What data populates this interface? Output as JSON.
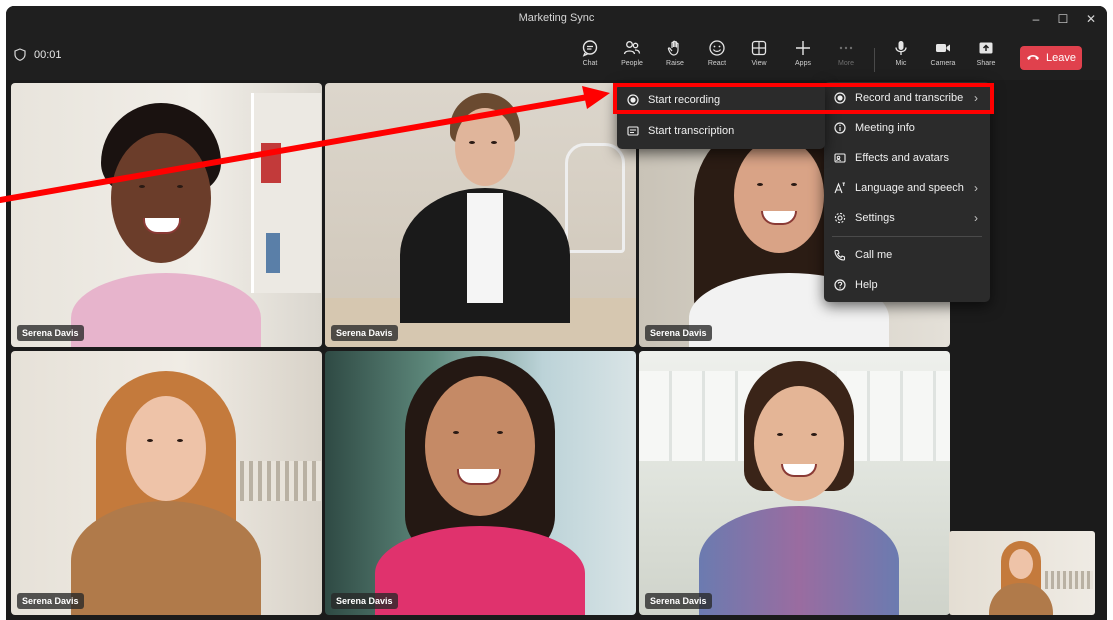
{
  "window": {
    "title": "Marketing Sync"
  },
  "titlebar_controls": {
    "minimize": "–",
    "maximize": "☐",
    "close": "✕"
  },
  "toolbar": {
    "timer": "00:01",
    "buttons": [
      {
        "label": "Chat",
        "icon": "chat-icon"
      },
      {
        "label": "People",
        "icon": "people-icon"
      },
      {
        "label": "Raise",
        "icon": "raise-hand-icon"
      },
      {
        "label": "React",
        "icon": "react-icon"
      },
      {
        "label": "View",
        "icon": "view-icon"
      },
      {
        "label": "Apps",
        "icon": "apps-icon"
      },
      {
        "label": "More",
        "icon": "more-icon"
      },
      {
        "label": "Mic",
        "icon": "mic-icon"
      },
      {
        "label": "Camera",
        "icon": "camera-icon"
      },
      {
        "label": "Share",
        "icon": "share-icon"
      }
    ],
    "leave_label": "Leave"
  },
  "participants": [
    {
      "name": "Serena Davis"
    },
    {
      "name": "Serena Davis"
    },
    {
      "name": "Serena Davis"
    },
    {
      "name": "Serena Davis"
    },
    {
      "name": "Serena Davis"
    },
    {
      "name": "Serena Davis"
    }
  ],
  "more_menu": {
    "items": [
      {
        "label": "Record and transcribe",
        "icon": "record-icon",
        "has_submenu": true
      },
      {
        "label": "Meeting info",
        "icon": "info-icon",
        "has_submenu": false
      },
      {
        "label": "Effects and avatars",
        "icon": "effects-icon",
        "has_submenu": false
      },
      {
        "label": "Language and speech",
        "icon": "language-icon",
        "has_submenu": true
      },
      {
        "label": "Settings",
        "icon": "gear-icon",
        "has_submenu": true
      },
      {
        "label": "Call me",
        "icon": "phone-icon",
        "has_submenu": false
      },
      {
        "label": "Help",
        "icon": "help-icon",
        "has_submenu": false
      }
    ],
    "chevron": "›"
  },
  "record_submenu": {
    "items": [
      {
        "label": "Start recording",
        "icon": "record-icon"
      },
      {
        "label": "Start transcription",
        "icon": "transcript-icon"
      }
    ]
  },
  "colors": {
    "leave": "#e0414d",
    "annotation": "#ff0000",
    "app_bg": "#1f1f1f",
    "menu_bg": "#2b2b2b"
  }
}
